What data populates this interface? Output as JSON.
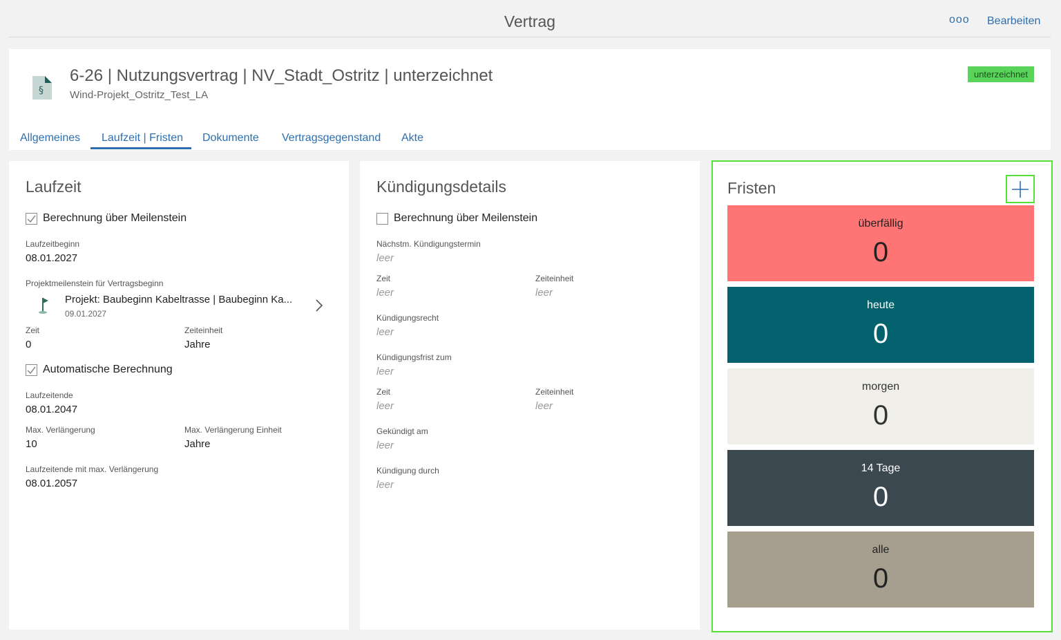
{
  "topbar": {
    "title": "Vertrag",
    "more": "ooo",
    "edit": "Bearbeiten"
  },
  "header": {
    "title": "6-26 | Nutzungsvertrag | NV_Stadt_Ostritz | unterzeichnet",
    "subtitle": "Wind-Projekt_Ostritz_Test_LA",
    "status": "unterzeichnet",
    "icon": "contract-document-icon"
  },
  "tabs": [
    "Allgemeines",
    "Laufzeit | Fristen",
    "Dokumente",
    "Vertragsgegenstand",
    "Akte"
  ],
  "laufzeit": {
    "title": "Laufzeit",
    "calc_milestone": {
      "label": "Berechnung über Meilenstein",
      "checked": true
    },
    "beginn_label": "Laufzeitbeginn",
    "beginn_value": "08.01.2027",
    "milestone_label": "Projektmeilenstein für Vertragsbeginn",
    "milestone_name": "Projekt: Baubeginn Kabeltrasse | Baubeginn Ka...",
    "milestone_date": "09.01.2027",
    "zeit_label": "Zeit",
    "zeit_value": "0",
    "einheit_label": "Zeiteinheit",
    "einheit_value": "Jahre",
    "auto_calc": {
      "label": "Automatische Berechnung",
      "checked": true
    },
    "ende_label": "Laufzeitende",
    "ende_value": "08.01.2047",
    "max_label": "Max. Verlängerung",
    "max_value": "10",
    "max_unit_label": "Max. Verlängerung Einheit",
    "max_unit_value": "Jahre",
    "ende_max_label": "Laufzeitende mit max. Verlängerung",
    "ende_max_value": "08.01.2057"
  },
  "kuendigung": {
    "title": "Kündigungsdetails",
    "calc_milestone": {
      "label": "Berechnung über Meilenstein",
      "checked": false
    },
    "naechst_label": "Nächstm. Kündigungstermin",
    "zeit_label": "Zeit",
    "einheit_label": "Zeiteinheit",
    "recht_label": "Kündigungsrecht",
    "frist_label": "Kündigungsfrist zum",
    "zeit2_label": "Zeit",
    "einheit2_label": "Zeiteinheit",
    "gekuendigt_label": "Gekündigt am",
    "durch_label": "Kündigung durch",
    "empty": "leer"
  },
  "fristen": {
    "title": "Fristen",
    "tiles": [
      {
        "label": "überfällig",
        "count": "0",
        "bg": "#ff7474",
        "fg": "#222222"
      },
      {
        "label": "heute",
        "count": "0",
        "bg": "#03626e",
        "fg": "#ffffff"
      },
      {
        "label": "morgen",
        "count": "0",
        "bg": "#f1efe9",
        "fg": "#333333"
      },
      {
        "label": "14 Tage",
        "count": "0",
        "bg": "#3b4850",
        "fg": "#ffffff"
      },
      {
        "label": "alle",
        "count": "0",
        "bg": "#a69f90",
        "fg": "#222222"
      }
    ]
  }
}
